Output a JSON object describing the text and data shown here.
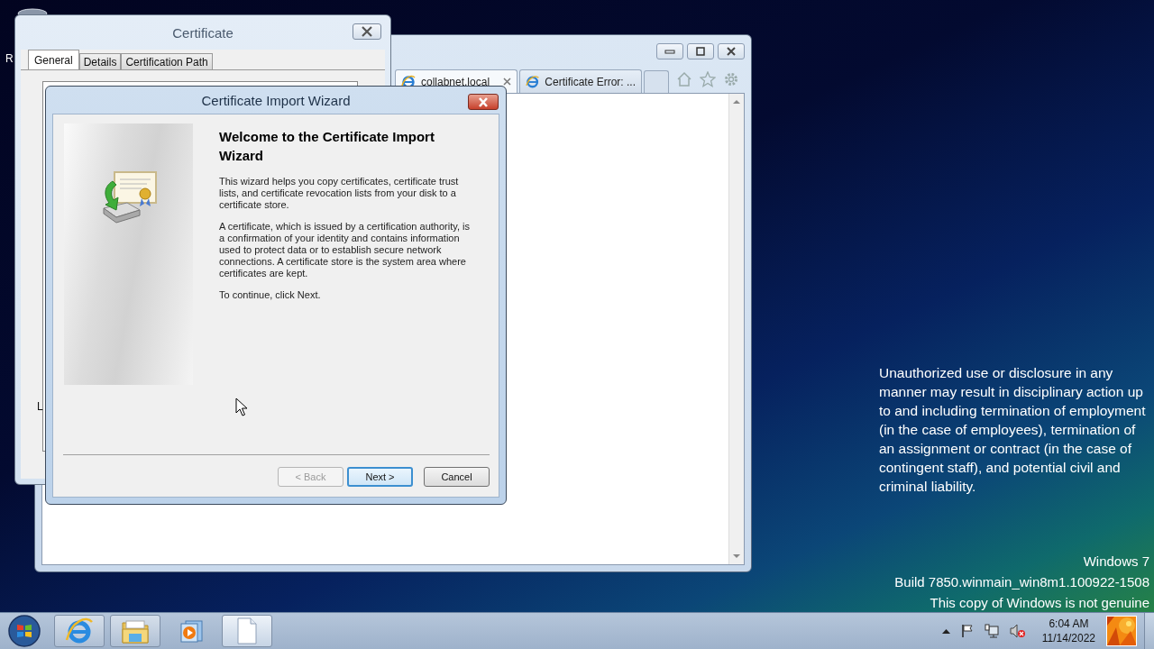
{
  "desktop": {
    "icon_labels": [
      "R"
    ]
  },
  "browser": {
    "tabs": [
      {
        "label": "collabnet.local",
        "selected": true
      },
      {
        "label": "Certificate Error: ...",
        "selected": false
      }
    ]
  },
  "certificate_dialog": {
    "title": "Certificate",
    "tabs": [
      {
        "label": "General",
        "selected": true
      },
      {
        "label": "Details",
        "selected": false
      },
      {
        "label": "Certification Path",
        "selected": false
      }
    ],
    "partial_text": "L"
  },
  "wizard": {
    "title": "Certificate Import Wizard",
    "heading": "Welcome to the Certificate Import Wizard",
    "paragraphs": [
      "This wizard helps you copy certificates, certificate trust lists, and certificate revocation lists from your disk to a certificate store.",
      "A certificate, which is issued by a certification authority, is a confirmation of your identity and contains information used to protect data or to establish secure network connections. A certificate store is the system area where certificates are kept.",
      "To continue, click Next."
    ],
    "buttons": [
      {
        "label": "< Back",
        "disabled": true,
        "default": false
      },
      {
        "label": "Next >",
        "disabled": false,
        "default": true
      },
      {
        "label": "Cancel",
        "disabled": false,
        "default": false
      }
    ]
  },
  "notice": "Unauthorized use or disclosure in any manner may result in disciplinary action up to and including termination of employment (in the case of employees), termination of an assignment or contract (in the case of contingent staff), and potential civil and criminal liability.",
  "build_info": [
    "Windows 7",
    "Build 7850.winmain_win8m1.100922-1508",
    "This copy of Windows is not genuine"
  ],
  "taskbar": {
    "apps": [
      {
        "kind": "browser",
        "running": true,
        "active": false
      },
      {
        "kind": "folder",
        "running": true,
        "active": false
      },
      {
        "kind": "media",
        "running": false,
        "active": false
      },
      {
        "kind": "document",
        "running": true,
        "active": true
      }
    ],
    "clock": {
      "time": "6:04 AM",
      "date": "11/14/2022"
    }
  }
}
